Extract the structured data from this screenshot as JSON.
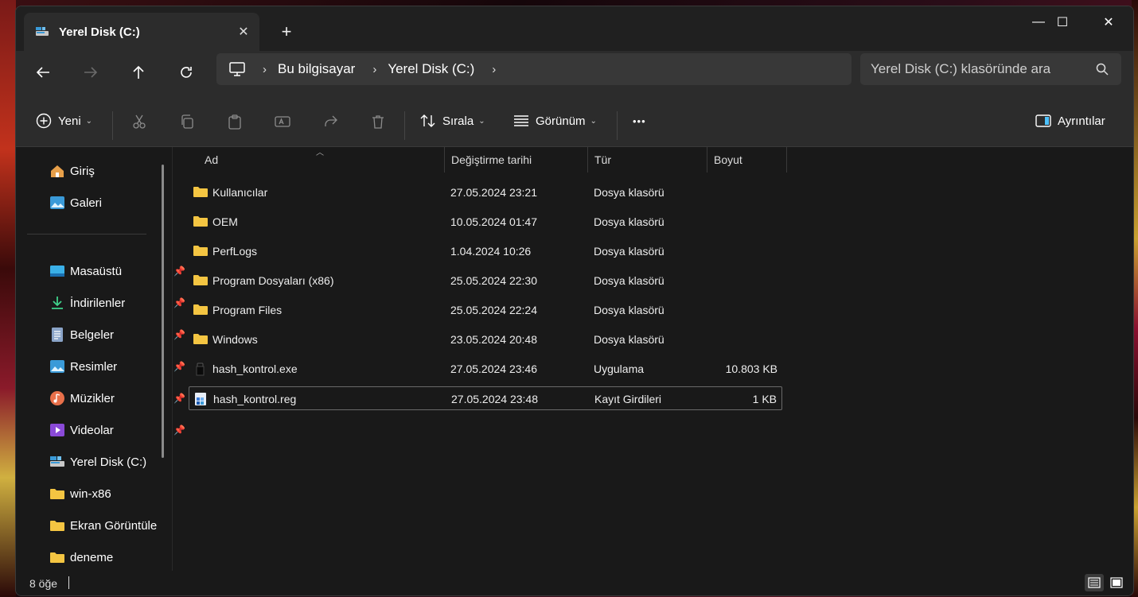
{
  "tab": {
    "title": "Yerel Disk (C:)",
    "close": "✕",
    "new": "+"
  },
  "window": {
    "minimize": "—",
    "maximize": "☐",
    "close": "✕"
  },
  "breadcrumb": {
    "items": [
      "Bu bilgisayar",
      "Yerel Disk (C:)"
    ],
    "separator": "›"
  },
  "search": {
    "placeholder": "Yerel Disk (C:) klasöründe ara"
  },
  "toolbar": {
    "new_label": "Yeni",
    "sort_label": "Sırala",
    "view_label": "Görünüm",
    "more_label": "•••",
    "details_label": "Ayrıntılar"
  },
  "sidebar": {
    "quick": [
      {
        "label": "Giriş",
        "icon": "home-icon"
      },
      {
        "label": "Galeri",
        "icon": "gallery-icon"
      }
    ],
    "pinned": [
      {
        "label": "Masaüstü",
        "icon": "desktop-icon"
      },
      {
        "label": "İndirilenler",
        "icon": "download-icon"
      },
      {
        "label": "Belgeler",
        "icon": "documents-icon"
      },
      {
        "label": "Resimler",
        "icon": "pictures-icon"
      },
      {
        "label": "Müzikler",
        "icon": "music-icon"
      },
      {
        "label": "Videolar",
        "icon": "videos-icon"
      }
    ],
    "other": [
      {
        "label": "Yerel Disk (C:)",
        "icon": "drive-icon"
      },
      {
        "label": "win-x86",
        "icon": "folder-icon"
      },
      {
        "label": "Ekran Görüntüle",
        "icon": "folder-icon"
      },
      {
        "label": "deneme",
        "icon": "folder-icon"
      }
    ]
  },
  "columns": {
    "name": "Ad",
    "date": "Değiştirme tarihi",
    "type": "Tür",
    "size": "Boyut"
  },
  "files": [
    {
      "name": "Kullanıcılar",
      "date": "27.05.2024 23:21",
      "type": "Dosya klasörü",
      "size": "",
      "icon": "folder-icon"
    },
    {
      "name": "OEM",
      "date": "10.05.2024 01:47",
      "type": "Dosya klasörü",
      "size": "",
      "icon": "folder-icon"
    },
    {
      "name": "PerfLogs",
      "date": "1.04.2024 10:26",
      "type": "Dosya klasörü",
      "size": "",
      "icon": "folder-icon"
    },
    {
      "name": "Program Dosyaları (x86)",
      "date": "25.05.2024 22:30",
      "type": "Dosya klasörü",
      "size": "",
      "icon": "folder-icon"
    },
    {
      "name": "Program Files",
      "date": "25.05.2024 22:24",
      "type": "Dosya klasörü",
      "size": "",
      "icon": "folder-icon"
    },
    {
      "name": "Windows",
      "date": "23.05.2024 20:48",
      "type": "Dosya klasörü",
      "size": "",
      "icon": "folder-icon"
    },
    {
      "name": "hash_kontrol.exe",
      "date": "27.05.2024 23:46",
      "type": "Uygulama",
      "size": "10.803 KB",
      "icon": "exe-icon"
    },
    {
      "name": "hash_kontrol.reg",
      "date": "27.05.2024 23:48",
      "type": "Kayıt Girdileri",
      "size": "1 KB",
      "icon": "registry-icon"
    }
  ],
  "status": {
    "count": "8 öğe"
  },
  "colors": {
    "window_bg": "#191919",
    "toolbar_bg": "#2c2c2c",
    "folder": "#f4c542",
    "accent": "#4cc2ff"
  }
}
